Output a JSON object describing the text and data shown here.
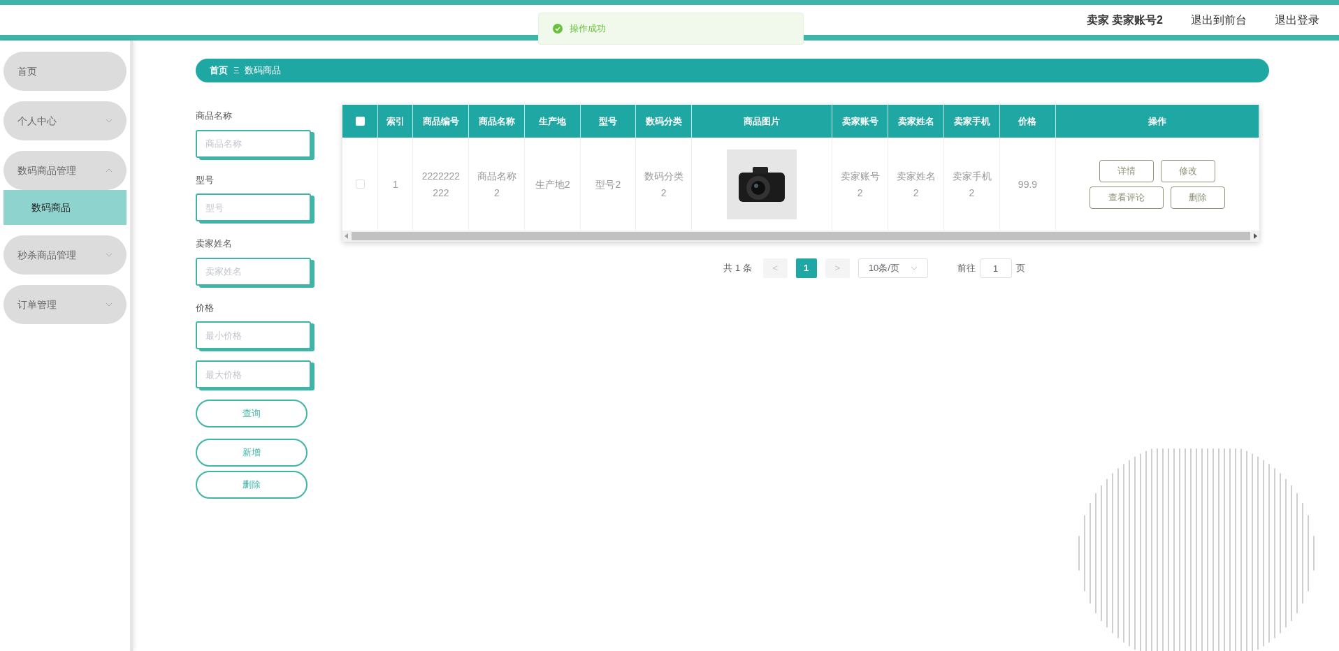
{
  "toast": {
    "text": "操作成功"
  },
  "header": {
    "user": "卖家 卖家账号2",
    "links": [
      "退出到前台",
      "退出登录"
    ]
  },
  "sidebar": {
    "items": [
      {
        "kind": "link",
        "label": "首页"
      },
      {
        "kind": "group",
        "label": "个人中心",
        "expanded": false
      },
      {
        "kind": "group",
        "label": "数码商品管理",
        "expanded": true,
        "children": [
          {
            "label": "数码商品",
            "selected": true
          }
        ]
      },
      {
        "kind": "group",
        "label": "秒杀商品管理",
        "expanded": false
      },
      {
        "kind": "group",
        "label": "订单管理",
        "expanded": false
      }
    ]
  },
  "breadcrumb": [
    "首页",
    "数码商品"
  ],
  "breadcrumb_separator": "Ξ",
  "filters": [
    {
      "label": "商品名称",
      "fields": [
        {
          "placeholder": "商品名称"
        }
      ]
    },
    {
      "label": "型号",
      "fields": [
        {
          "placeholder": "型号"
        }
      ]
    },
    {
      "label": "卖家姓名",
      "fields": [
        {
          "placeholder": "卖家姓名"
        }
      ]
    },
    {
      "label": "价格",
      "fields": [
        {
          "placeholder": "最小价格"
        },
        {
          "placeholder": "最大价格"
        }
      ]
    }
  ],
  "filter_buttons": [
    "查询",
    "新增",
    "删除"
  ],
  "table": {
    "columns": [
      "索引",
      "商品编号",
      "商品名称",
      "生产地",
      "型号",
      "数码分类",
      "商品图片",
      "卖家账号",
      "卖家姓名",
      "卖家手机",
      "价格",
      "操作"
    ],
    "all_checked": false,
    "rows": [
      {
        "checked": false,
        "cells": [
          "1",
          "2222222222",
          "商品名称2",
          "生产地2",
          "型号2",
          "数码分类2",
          "",
          "卖家账号2",
          "卖家姓名2",
          "卖家手机2",
          "99.9"
        ],
        "actions": [
          "详情",
          "修改",
          "查看评论",
          "删除"
        ]
      }
    ]
  },
  "pagination": {
    "total": "共 1 条",
    "prev": "<",
    "pages": [
      {
        "label": "1",
        "selected": true
      }
    ],
    "next": ">",
    "page_size": "10条/页",
    "goto_label": "前往",
    "goto_value": "1",
    "goto_suffix": "页"
  }
}
